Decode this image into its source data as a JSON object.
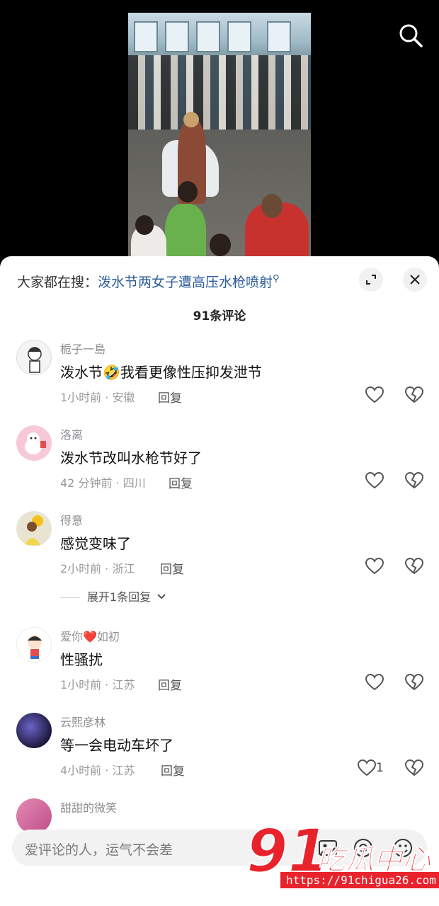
{
  "hot_search": {
    "prefix": "大家都在搜：",
    "query": "泼水节两女子遭高压水枪喷射"
  },
  "comment_count": "91条评论",
  "comments": [
    {
      "name": "栀子一島",
      "text": "泼水节🤣我看更像性压抑发泄节",
      "meta": "1小时前 · 安徽",
      "reply": "回复",
      "likes": ""
    },
    {
      "name": "洛离",
      "text": "泼水节改叫水枪节好了",
      "meta": "42 分钟前 · 四川",
      "reply": "回复",
      "likes": ""
    },
    {
      "name": "得意",
      "text": "感觉变味了",
      "meta": "2小时前 · 浙江",
      "reply": "回复",
      "likes": ""
    },
    {
      "name": "爱你❤️如初",
      "text": "性骚扰",
      "meta": "1小时前 · 江苏",
      "reply": "回复",
      "likes": ""
    },
    {
      "name": "云熙彦林",
      "text": "等一会电动车坏了",
      "meta": "4小时前 · 江苏",
      "reply": "回复",
      "likes": "1"
    },
    {
      "name": "甜甜的微笑",
      "text": "",
      "meta": "",
      "reply": "",
      "likes": ""
    }
  ],
  "expand_replies": "展开1条回复",
  "input": {
    "placeholder": "爱评论的人，运气不会差"
  },
  "watermark": {
    "brand": "91",
    "brand_cn": "吃瓜中心",
    "url": "https://91chigua26.com"
  },
  "colors": {
    "accent_link": "#2a5b9a",
    "watermark_red": "#e8232c"
  },
  "icons": [
    "search-icon",
    "expand-icon",
    "close-icon",
    "heart-icon",
    "broken-heart-icon",
    "image-icon",
    "at-icon",
    "emoji-icon"
  ]
}
